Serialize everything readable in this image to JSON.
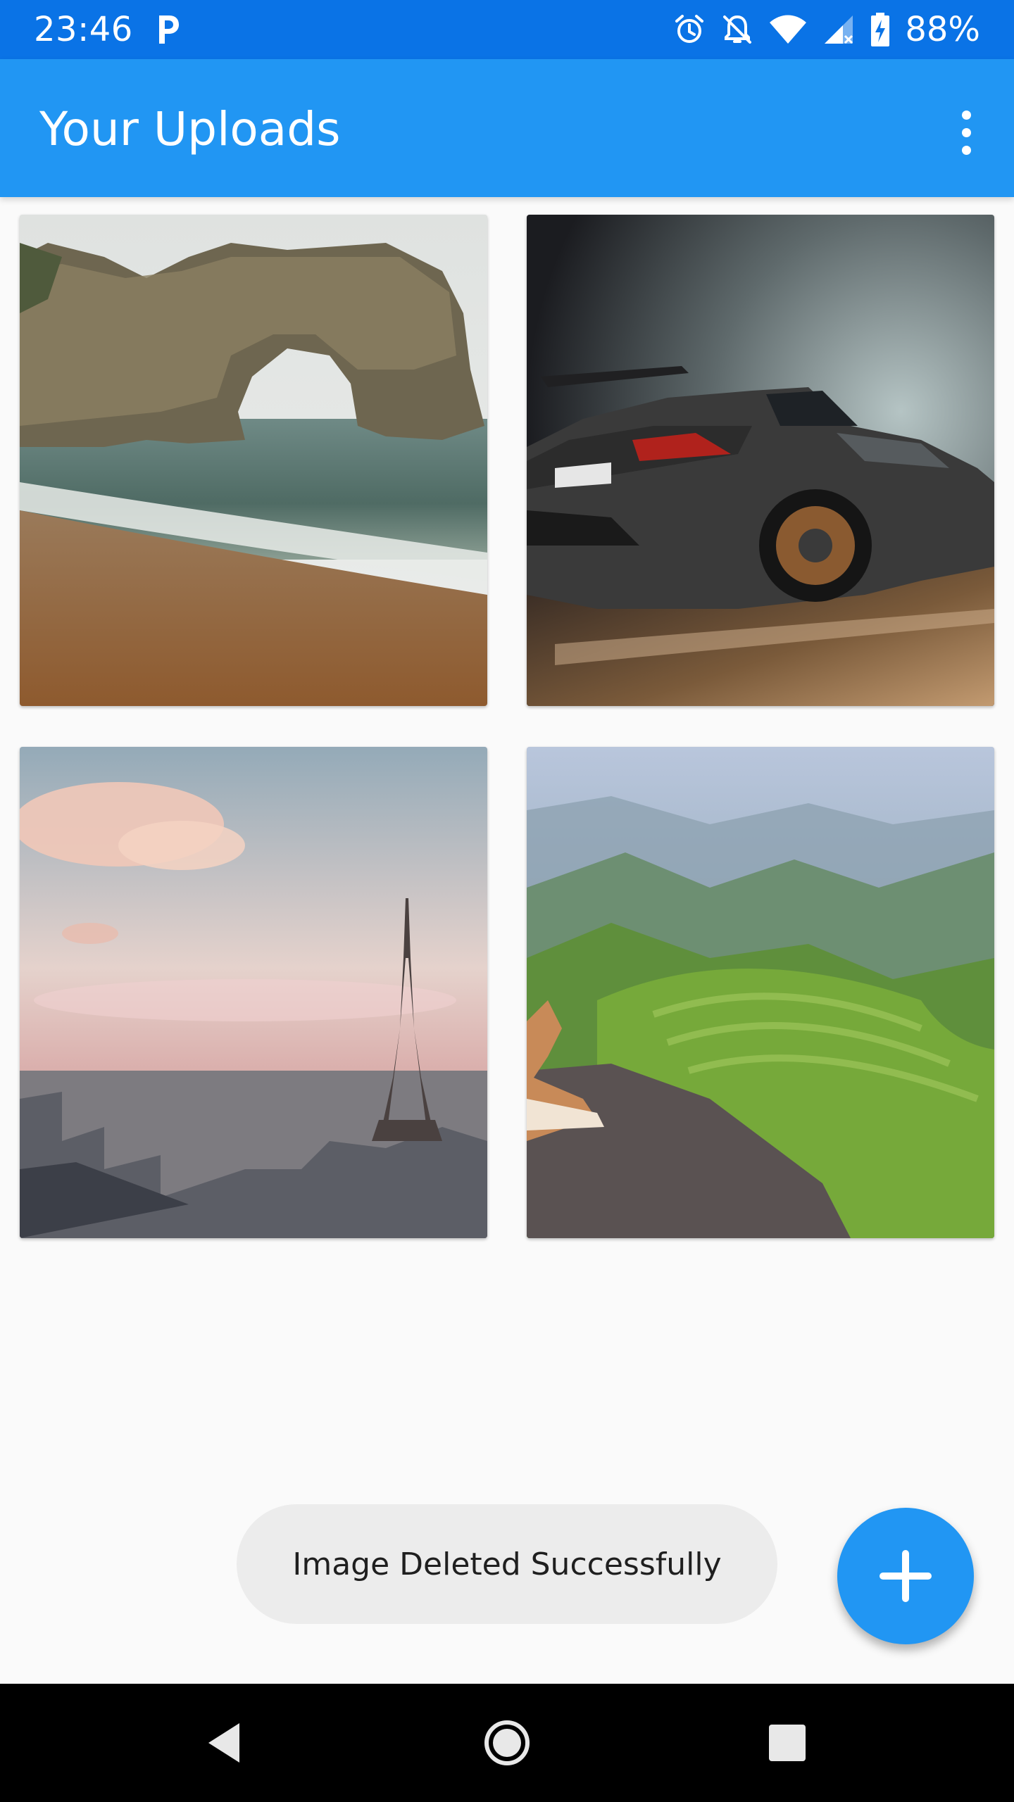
{
  "status_bar": {
    "time": "23:46",
    "battery_percent": "88%",
    "icons": [
      "p-notification-icon",
      "alarm-icon",
      "notifications-off-icon",
      "wifi-icon",
      "cellular-signal-icon",
      "battery-charging-icon"
    ]
  },
  "app_bar": {
    "title": "Your Uploads",
    "overflow_icon": "more-vert-icon"
  },
  "gallery": {
    "images": [
      {
        "subject": "sea-arch-beach-photo"
      },
      {
        "subject": "sports-car-photo"
      },
      {
        "subject": "eiffel-tower-city-photo"
      },
      {
        "subject": "rice-terraces-dog-photo"
      }
    ]
  },
  "toast": {
    "message": "Image Deleted Successfully"
  },
  "fab": {
    "icon": "add-icon"
  },
  "nav_bar": {
    "icons": [
      "back-icon",
      "home-icon",
      "recents-icon"
    ]
  },
  "colors": {
    "status_bar": "#0a73e6",
    "app_bar": "#2196f3",
    "fab": "#2196f3",
    "toast_bg": "#ececec",
    "background": "#fafafa"
  }
}
